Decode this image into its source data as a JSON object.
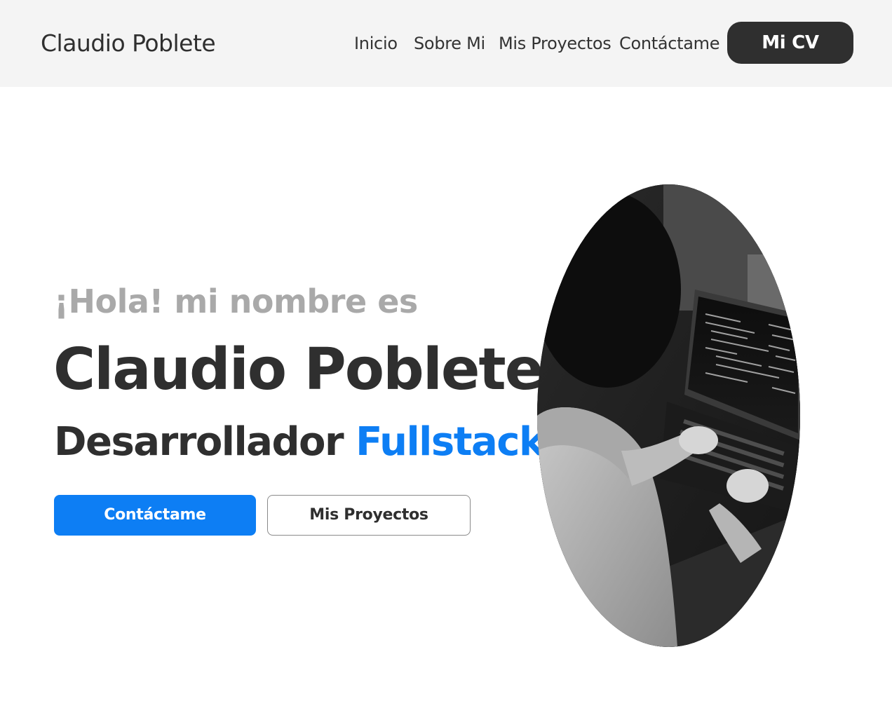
{
  "navbar": {
    "brand": "Claudio Poblete",
    "links": [
      {
        "label": "Inicio"
      },
      {
        "label": "Sobre Mi"
      },
      {
        "label": "Mis Proyectos"
      },
      {
        "label": "Contáctame"
      }
    ],
    "cv_button": "Mi CV"
  },
  "hero": {
    "greeting": "¡Hola! mi nombre es",
    "name": "Claudio Poblete",
    "role_prefix": "Desarrollador",
    "role_highlight": "Fullstack",
    "primary_button": "Contáctame",
    "secondary_button": "Mis Proyectos",
    "photo_icon": "person-coding-on-laptop-photo"
  },
  "colors": {
    "accent": "#0d7ef4",
    "dark": "#2f2f2f",
    "muted": "#a9a9a9",
    "navbar_bg": "#f4f4f4"
  }
}
